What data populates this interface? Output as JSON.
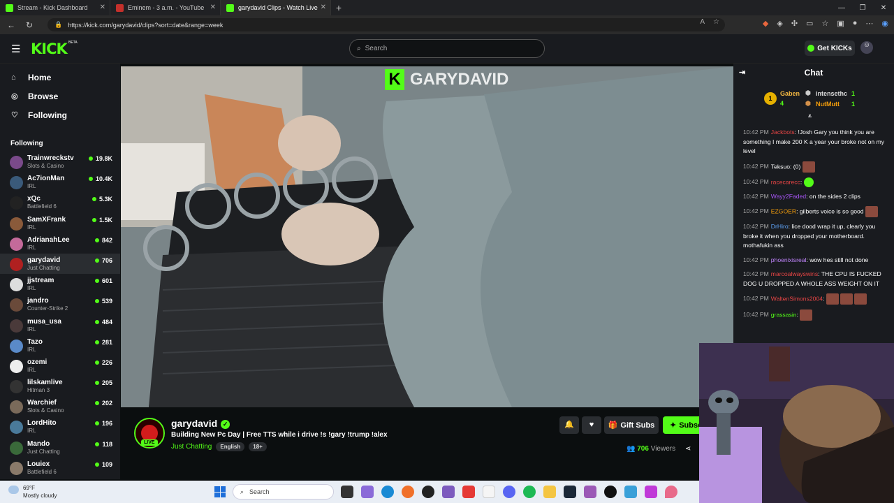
{
  "browser": {
    "tabs": [
      {
        "title": "Stream - Kick Dashboard",
        "color": "#53fc18"
      },
      {
        "title": "Eminem - 3 a.m. - YouTube",
        "color": "#c4302b"
      },
      {
        "title": "garydavid Clips - Watch Live",
        "color": "#53fc18"
      }
    ],
    "url": "https://kick.com/garydavid/clips?sort=date&range=week"
  },
  "header": {
    "logo": "KICK",
    "beta": "BETA",
    "search_placeholder": "Search",
    "get_kicks": "Get KICKs"
  },
  "sidebar": {
    "nav": [
      {
        "label": "Home",
        "icon": "home-icon"
      },
      {
        "label": "Browse",
        "icon": "compass-icon"
      },
      {
        "label": "Following",
        "icon": "heart-icon"
      }
    ],
    "following_heading": "Following",
    "following": [
      {
        "name": "Trainwreckstv",
        "category": "Slots & Casino",
        "viewers": "19.8K"
      },
      {
        "name": "Ac7ionMan",
        "category": "IRL",
        "viewers": "10.4K"
      },
      {
        "name": "xQc",
        "category": "Battlefield 6",
        "viewers": "5.3K"
      },
      {
        "name": "SamXFrank",
        "category": "IRL",
        "viewers": "1.5K"
      },
      {
        "name": "AdrianahLee",
        "category": "IRL",
        "viewers": "842"
      },
      {
        "name": "garydavid",
        "category": "Just Chatting",
        "viewers": "706"
      },
      {
        "name": "jjstream",
        "category": "IRL",
        "viewers": "601"
      },
      {
        "name": "jandro",
        "category": "Counter-Strike 2",
        "viewers": "539"
      },
      {
        "name": "musa_usa",
        "category": "IRL",
        "viewers": "484"
      },
      {
        "name": "Tazo",
        "category": "IRL",
        "viewers": "281"
      },
      {
        "name": "ozemi",
        "category": "IRL",
        "viewers": "226"
      },
      {
        "name": "lilskamlive",
        "category": "Hitman 3",
        "viewers": "205"
      },
      {
        "name": "Warchief",
        "category": "Slots & Casino",
        "viewers": "202"
      },
      {
        "name": "LordHito",
        "category": "IRL",
        "viewers": "196"
      },
      {
        "name": "Mando",
        "category": "Just Chatting",
        "viewers": "118"
      },
      {
        "name": "Louiex",
        "category": "Battlefield 6",
        "viewers": "109"
      }
    ]
  },
  "video": {
    "watermark": "GARYDAVID"
  },
  "stream": {
    "channel": "garydavid",
    "live": "LIVE",
    "title": "Building New Pc Day | Free TTS while i drive !s !gary !trump !alex",
    "category": "Just Chatting",
    "tags": [
      "English",
      "18+"
    ],
    "gift_subs": "Gift Subs",
    "subscribe": "Subscribe",
    "viewers": "706",
    "viewers_label": "Viewers"
  },
  "chat": {
    "title": "Chat",
    "leaderboard": {
      "first": {
        "name": "Gaben",
        "count": "4"
      },
      "second": {
        "name": "intensethc",
        "count": "1"
      },
      "third": {
        "name": "NutMutt",
        "count": "1"
      }
    },
    "messages": [
      {
        "time": "10:42 PM",
        "user": "Jackbots",
        "color": "#e84545",
        "text": ": !Josh Gary you think you are something I make 200 K a year your broke not on my level",
        "emotes": 0
      },
      {
        "time": "10:42 PM",
        "user": "Teksuo",
        "color": "#ffffff",
        "text": ": (0)",
        "emotes": 1
      },
      {
        "time": "10:42 PM",
        "user": "racecarecc",
        "color": "#e84545",
        "text": ":",
        "emotes": 1
      },
      {
        "time": "10:42 PM",
        "user": "Wayy2Faded",
        "color": "#a855f7",
        "text": ": on the sides 2 clips",
        "emotes": 0
      },
      {
        "time": "10:42 PM",
        "user": "EZGOER",
        "color": "#f59e0b",
        "text": ": gilberts voice is so good",
        "emotes": 1
      },
      {
        "time": "10:42 PM",
        "user": "DrHiro",
        "color": "#60a5fa",
        "text": ": lice dood wrap it up, clearly you broke it when you dropped your motherboard. mothafukin ass",
        "emotes": 0
      },
      {
        "time": "10:42 PM",
        "user": "phoenixisreal",
        "color": "#c084fc",
        "text": ": wow hes still not done",
        "emotes": 0
      },
      {
        "time": "10:42 PM",
        "user": "marcoalwayswins",
        "color": "#e84545",
        "text": ": THE CPU IS FUCKED DOG U DROPPED A WHOLE ASS WEIGHT ON IT",
        "emotes": 0
      },
      {
        "time": "10:42 PM",
        "user": "WaltenSimons2004",
        "color": "#e84545",
        "text": ":",
        "emotes": 3
      },
      {
        "time": "10:42 PM",
        "user": "grassasin",
        "color": "#53fc18",
        "text": ":",
        "emotes": 1
      }
    ]
  },
  "taskbar": {
    "temp": "69°F",
    "condition": "Mostly cloudy",
    "search": "Search"
  }
}
